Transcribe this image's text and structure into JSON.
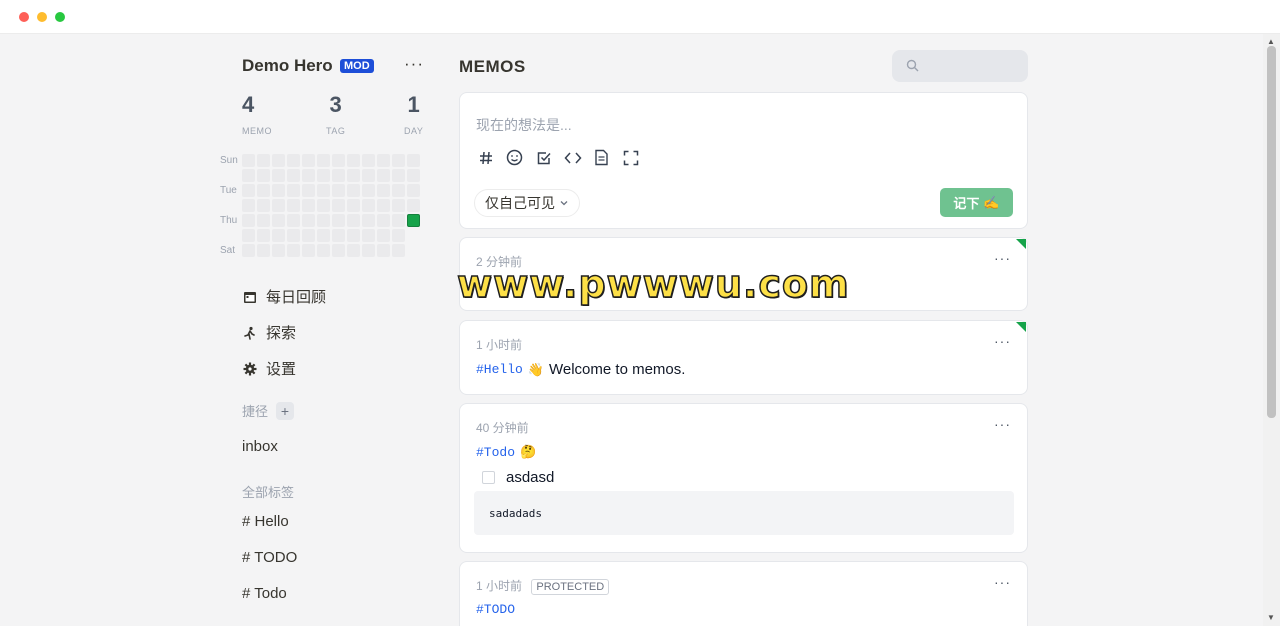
{
  "window": {
    "controls": [
      "close",
      "minimize",
      "maximize"
    ]
  },
  "user": {
    "name": "Demo Hero",
    "badge": "MOD"
  },
  "stats": [
    {
      "value": "4",
      "label": "MEMO"
    },
    {
      "value": "3",
      "label": "TAG"
    },
    {
      "value": "1",
      "label": "DAY"
    }
  ],
  "heatmap": {
    "day_labels": [
      "Sun",
      "Tue",
      "Thu",
      "Sat"
    ],
    "active_color": "#16a34a"
  },
  "nav": [
    {
      "label": "每日回顾",
      "icon": "calendar-icon"
    },
    {
      "label": "探索",
      "icon": "explore-icon"
    },
    {
      "label": "设置",
      "icon": "gear-icon"
    }
  ],
  "shortcuts": {
    "label": "捷径",
    "items": [
      "inbox"
    ]
  },
  "tags": {
    "label": "全部标签",
    "items": [
      "# Hello",
      "# TODO",
      "# Todo"
    ]
  },
  "main": {
    "title": "MEMOS"
  },
  "editor": {
    "placeholder": "现在的想法是...",
    "visibility": "仅自己可见",
    "save_label": "记下",
    "save_emoji": "✍️"
  },
  "memos": [
    {
      "time": "2 分钟前",
      "link_text": "e"
    },
    {
      "time": "1 小时前",
      "tag": "#Hello",
      "emoji": "👋",
      "text": "Welcome to memos."
    },
    {
      "time": "40 分钟前",
      "tag": "#Todo",
      "emoji": "🤔",
      "task": "asdasd",
      "code": "sadadads"
    },
    {
      "time": "1 小时前",
      "badge": "PROTECTED",
      "tag": "#TODO"
    }
  ],
  "watermark": "www.pwwwu.com",
  "colors": {
    "accent": "#6fc290",
    "link": "#2563eb",
    "badge": "#1d4ed8"
  }
}
